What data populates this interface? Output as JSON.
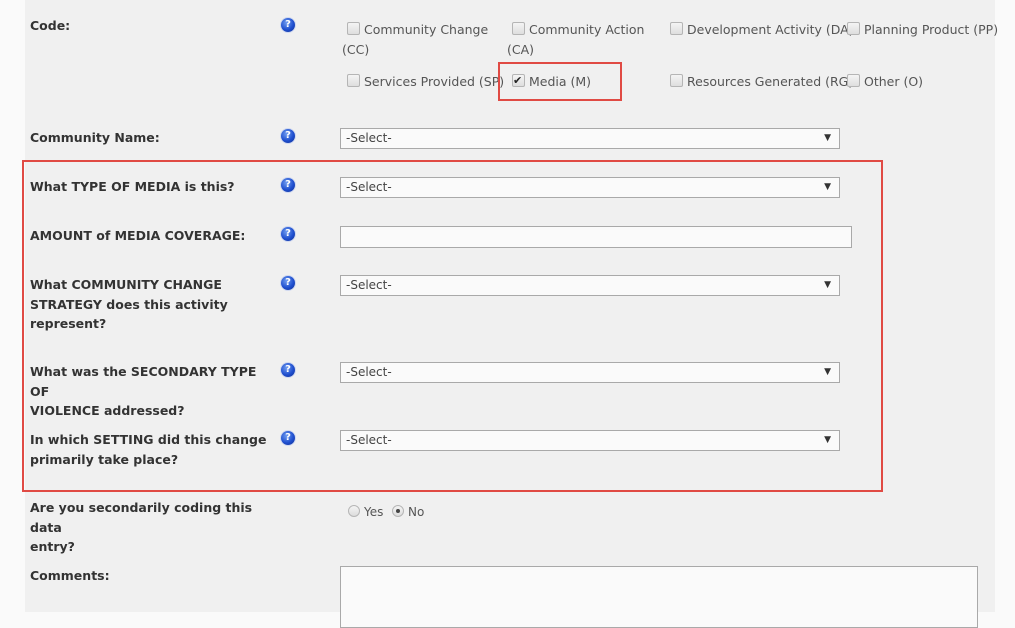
{
  "code": {
    "label": "Code:",
    "options": [
      {
        "label": "Community Change",
        "label2": "(CC)",
        "checked": false
      },
      {
        "label": "Community Action",
        "label2": "(CA)",
        "checked": false
      },
      {
        "label": "Development Activity (DA)",
        "checked": false
      },
      {
        "label": "Planning Product (PP)",
        "checked": false
      },
      {
        "label": "Services Provided (SP)",
        "checked": false
      },
      {
        "label": "Media (M)",
        "checked": true
      },
      {
        "label": "Resources Generated (RG)",
        "checked": false
      },
      {
        "label": "Other (O)",
        "checked": false
      }
    ]
  },
  "community_name": {
    "label": "Community Name:",
    "value": "-Select-"
  },
  "media_type": {
    "label": "What TYPE OF MEDIA is this?",
    "value": "-Select-"
  },
  "media_amount": {
    "label": "AMOUNT of MEDIA COVERAGE:",
    "value": ""
  },
  "strategy": {
    "label_lines": [
      "What COMMUNITY CHANGE",
      "STRATEGY does this activity",
      "represent?"
    ],
    "value": "-Select-"
  },
  "secondary_violence": {
    "label_lines": [
      "What was the SECONDARY TYPE OF",
      "VIOLENCE addressed?"
    ],
    "value": "-Select-"
  },
  "setting": {
    "label_lines": [
      "In which SETTING did this change",
      "primarily take place?"
    ],
    "value": "-Select-"
  },
  "secondary_coding": {
    "label_lines": [
      "Are you secondarily coding this data",
      "entry?"
    ],
    "options": [
      "Yes",
      "No"
    ],
    "selected": "No"
  },
  "comments": {
    "label": "Comments:",
    "value": ""
  },
  "icons": {
    "help": "?",
    "dropdown_arrow": "▼"
  },
  "colors": {
    "highlight": "#e04a44",
    "help_icon": "#1f4fcf",
    "panel": "#f0f0f0"
  }
}
